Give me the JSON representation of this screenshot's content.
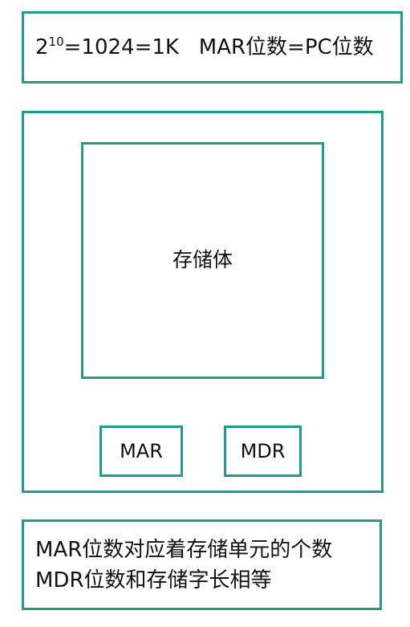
{
  "accent_color": "#1f9c8c",
  "formula": {
    "base": "2",
    "exponent": "10",
    "rest": "=1024=1K   MAR位数=PC位数"
  },
  "storage_label": "存储体",
  "registers": {
    "mar": "MAR",
    "mdr": "MDR"
  },
  "notes": {
    "line1": "MAR位数对应着存储单元的个数",
    "line2": "MDR位数和存储字长相等"
  }
}
